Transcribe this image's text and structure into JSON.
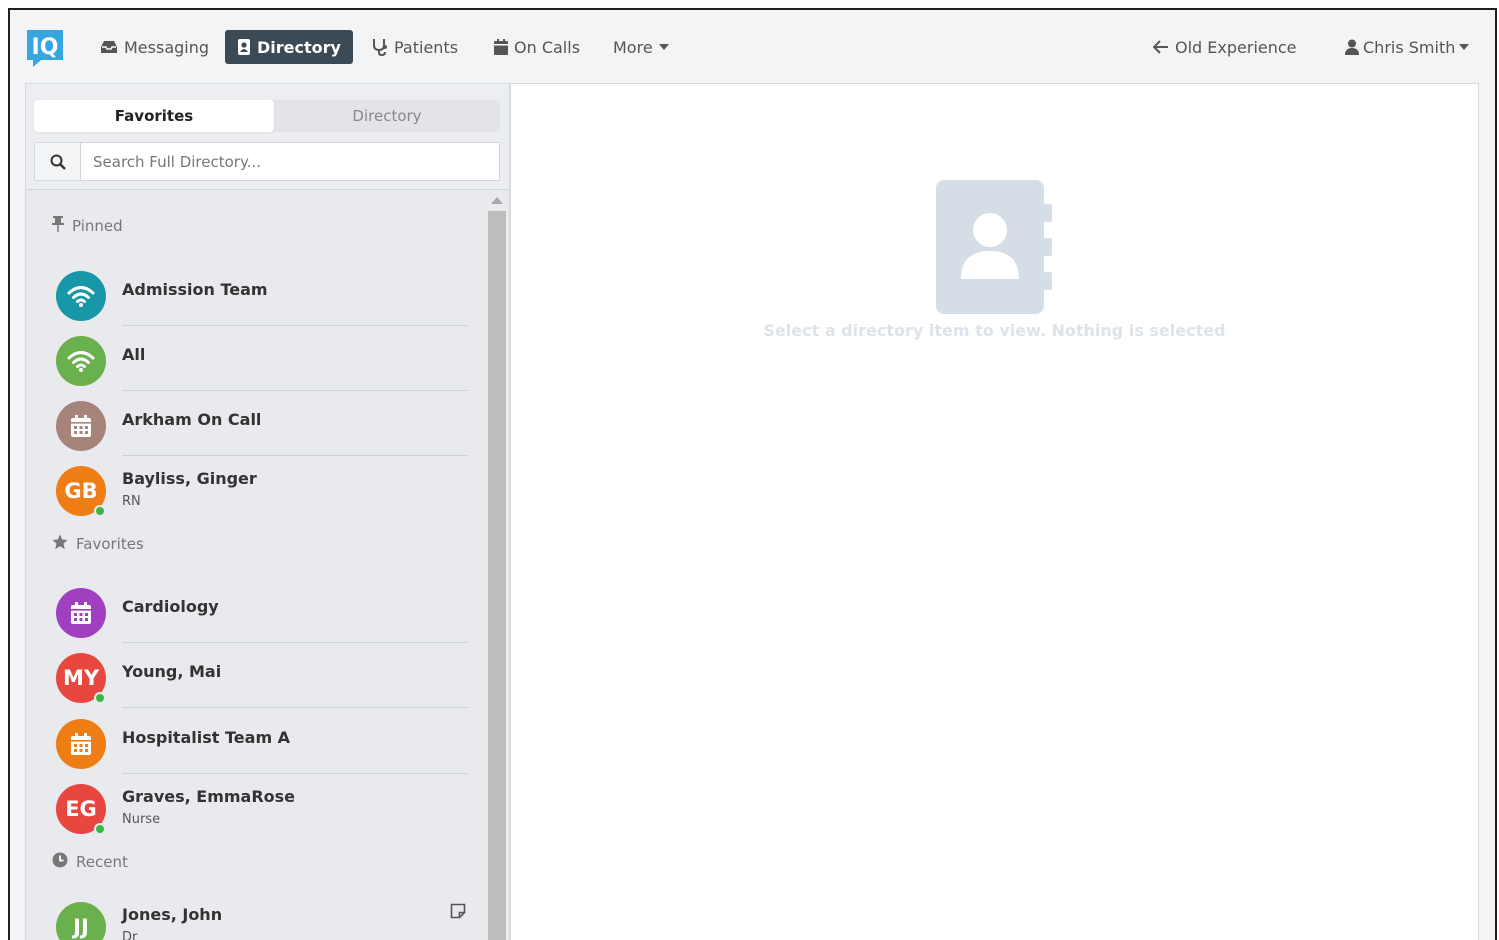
{
  "nav": {
    "logo_text": "IQ",
    "items": [
      {
        "label": "Messaging",
        "icon": "inbox-icon"
      },
      {
        "label": "Directory",
        "icon": "address-book-icon",
        "active": true
      },
      {
        "label": "Patients",
        "icon": "stethoscope-icon"
      },
      {
        "label": "On Calls",
        "icon": "calendar-icon"
      },
      {
        "label": "More",
        "icon": "caret-down-icon"
      }
    ],
    "old_experience": "Old Experience",
    "user": "Chris Smith"
  },
  "left_panel": {
    "tabs": [
      "Favorites",
      "Directory"
    ],
    "search_placeholder": "Search Full Directory...",
    "sections": {
      "pinned": "Pinned",
      "favorites": "Favorites",
      "recent": "Recent"
    },
    "pinned": [
      {
        "name": "Admission Team",
        "icon": "broadcast-icon",
        "color": "#1797a8"
      },
      {
        "name": "All",
        "icon": "broadcast-icon",
        "color": "#6ab04c"
      },
      {
        "name": "Arkham On Call",
        "icon": "calendar-icon",
        "color": "#a6847a"
      },
      {
        "name": "Bayliss, Ginger",
        "sub": "RN",
        "initials": "GB",
        "color": "#ef7d16",
        "online": true
      }
    ],
    "favorites": [
      {
        "name": "Cardiology",
        "icon": "calendar-icon",
        "color": "#a040c0"
      },
      {
        "name": "Young, Mai",
        "initials": "MY",
        "color": "#e8473f",
        "online": true
      },
      {
        "name": "Hospitalist Team A",
        "icon": "calendar-icon",
        "color": "#ef7d16"
      },
      {
        "name": "Graves, EmmaRose",
        "sub": "Nurse",
        "initials": "EG",
        "color": "#e8473f",
        "online": true
      }
    ],
    "recent": [
      {
        "name": "Jones, John",
        "sub": "Dr",
        "initials": "JJ",
        "color": "#6ab04c",
        "online": true
      }
    ]
  },
  "right_panel": {
    "empty_message": "Select a directory item to view. Nothing is selected"
  }
}
